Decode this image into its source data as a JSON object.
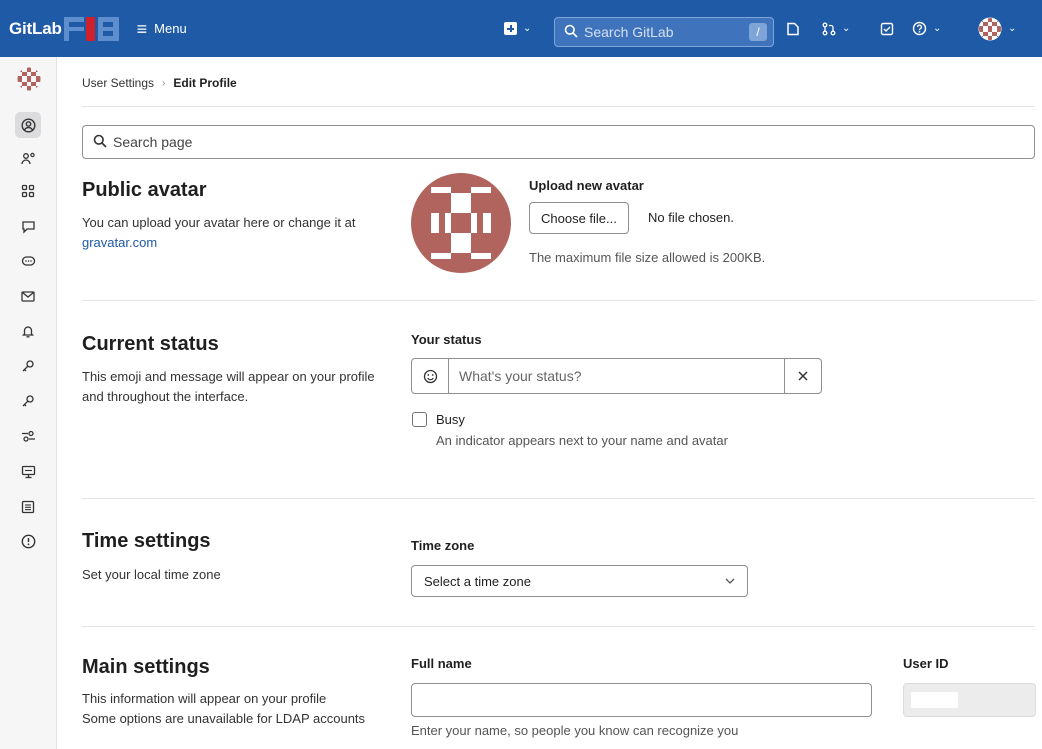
{
  "navbar": {
    "brand": "GitLab",
    "menu_label": "Menu",
    "search_placeholder": "Search GitLab",
    "search_shortcut": "/"
  },
  "breadcrumb": {
    "parent": "User Settings",
    "separator": "›",
    "current": "Edit Profile"
  },
  "page_search": {
    "placeholder": "Search page"
  },
  "public_avatar": {
    "title": "Public avatar",
    "description": "You can upload your avatar here or change it at ",
    "link": "gravatar.com",
    "upload_label": "Upload new avatar",
    "choose_button": "Choose file...",
    "no_file": "No file chosen.",
    "max_size": "The maximum file size allowed is 200KB."
  },
  "current_status": {
    "title": "Current status",
    "description": "This emoji and message will appear on your profile and throughout the interface.",
    "label": "Your status",
    "placeholder": "What's your status?",
    "busy_label": "Busy",
    "busy_help": "An indicator appears next to your name and avatar"
  },
  "time_settings": {
    "title": "Time settings",
    "description": "Set your local time zone",
    "label": "Time zone",
    "select_value": "Select a time zone"
  },
  "main_settings": {
    "title": "Main settings",
    "description_line1": "This information will appear on your profile",
    "description_line2": "Some options are unavailable for LDAP accounts",
    "full_name_label": "Full name",
    "full_name_help": "Enter your name, so people you know can recognize you",
    "user_id_label": "User ID"
  },
  "colors": {
    "navbar": "#1f5aa6",
    "avatar": "#b0645d",
    "link": "#1f5aa6"
  }
}
